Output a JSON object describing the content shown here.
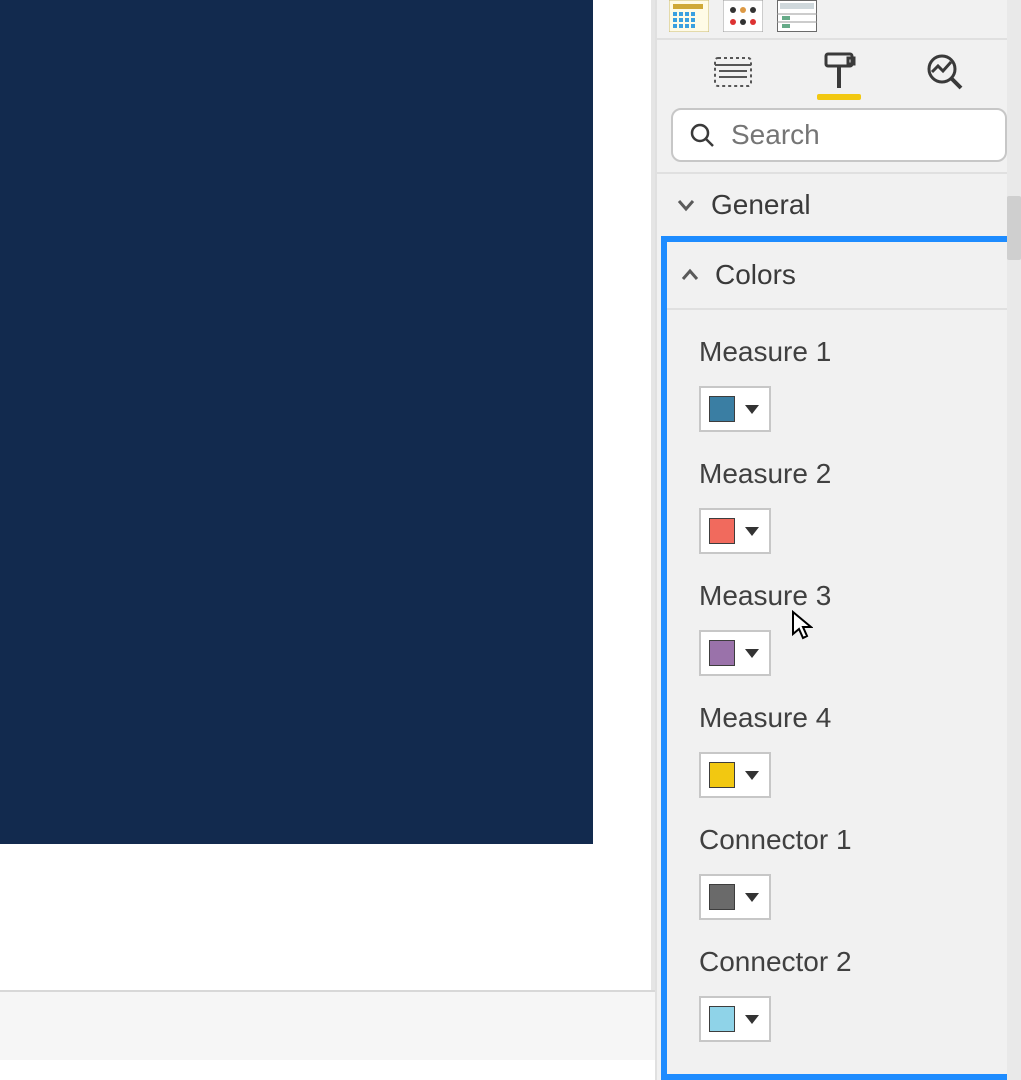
{
  "search": {
    "placeholder": "Search",
    "value": ""
  },
  "sections": {
    "general": {
      "label": "General"
    },
    "colors": {
      "label": "Colors"
    }
  },
  "colors": {
    "items": [
      {
        "label": "Measure 1",
        "swatch": "#3a7ea3"
      },
      {
        "label": "Measure 2",
        "swatch": "#f16a5d"
      },
      {
        "label": "Measure 3",
        "swatch": "#9a72aa"
      },
      {
        "label": "Measure 4",
        "swatch": "#f2c811"
      },
      {
        "label": "Connector 1",
        "swatch": "#6a6a6a"
      },
      {
        "label": "Connector 2",
        "swatch": "#8fd3e8"
      }
    ]
  },
  "tabs": {
    "fields_tooltip": "Fields",
    "format_tooltip": "Format",
    "analytics_tooltip": "Analytics",
    "active": "format"
  },
  "viz_icons": [
    "matrix-icon",
    "r-visual-icon",
    "table-icon"
  ]
}
